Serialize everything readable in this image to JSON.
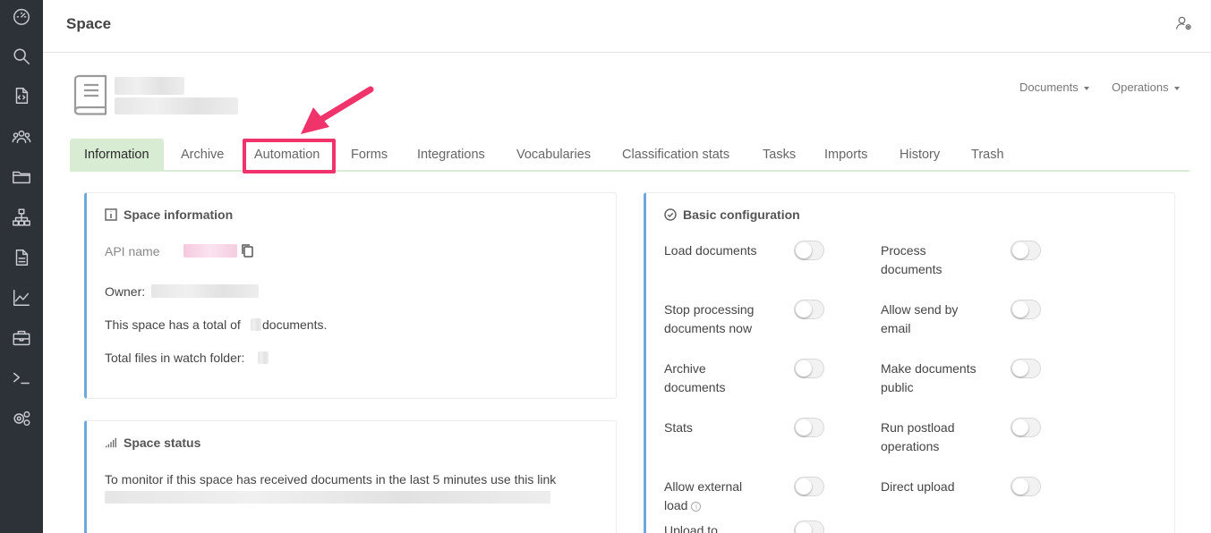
{
  "header": {
    "title": "Space"
  },
  "sidebar": {
    "icons": [
      "dashboard-icon",
      "search-icon",
      "code-file-icon",
      "users-icon",
      "folder-icon",
      "hierarchy-icon",
      "document-icon",
      "chart-icon",
      "toolbox-icon",
      "terminal-icon",
      "settings-icon"
    ]
  },
  "menus": {
    "documents": "Documents",
    "operations": "Operations"
  },
  "tabs": [
    {
      "label": "Information"
    },
    {
      "label": "Archive"
    },
    {
      "label": "Automation"
    },
    {
      "label": "Forms"
    },
    {
      "label": "Integrations"
    },
    {
      "label": "Vocabularies"
    },
    {
      "label": "Classification stats"
    },
    {
      "label": "Tasks"
    },
    {
      "label": "Imports"
    },
    {
      "label": "History"
    },
    {
      "label": "Trash"
    }
  ],
  "space_info": {
    "title": "Space information",
    "api_name_label": "API name",
    "owner_label": "Owner:",
    "total_prefix": "This space has a total of",
    "total_suffix": "documents.",
    "watch_folder_label": "Total files in watch folder:"
  },
  "space_status": {
    "title": "Space status",
    "monitor_text": "To monitor if this space has received documents in the last 5 minutes use this link"
  },
  "basic_config": {
    "title": "Basic configuration",
    "items": [
      {
        "label": "Load documents",
        "on": false
      },
      {
        "label": "Process documents",
        "on": false
      },
      {
        "label": "Stop processing documents now",
        "on": false
      },
      {
        "label": "Allow send by email",
        "on": false
      },
      {
        "label": "Archive documents",
        "on": false
      },
      {
        "label": "Make documents public",
        "on": false
      },
      {
        "label": "Stats",
        "on": false
      },
      {
        "label": "Run postload operations",
        "on": false
      },
      {
        "label": "Allow external load",
        "on": false
      },
      {
        "label": "Direct upload",
        "on": false
      },
      {
        "label": "Upload to",
        "on": false
      }
    ]
  },
  "colors": {
    "highlight": "#f0336a",
    "active_tab": "#d8ecd3",
    "card_accent": "#6fa8dc",
    "sidebar": "#2d3138"
  }
}
